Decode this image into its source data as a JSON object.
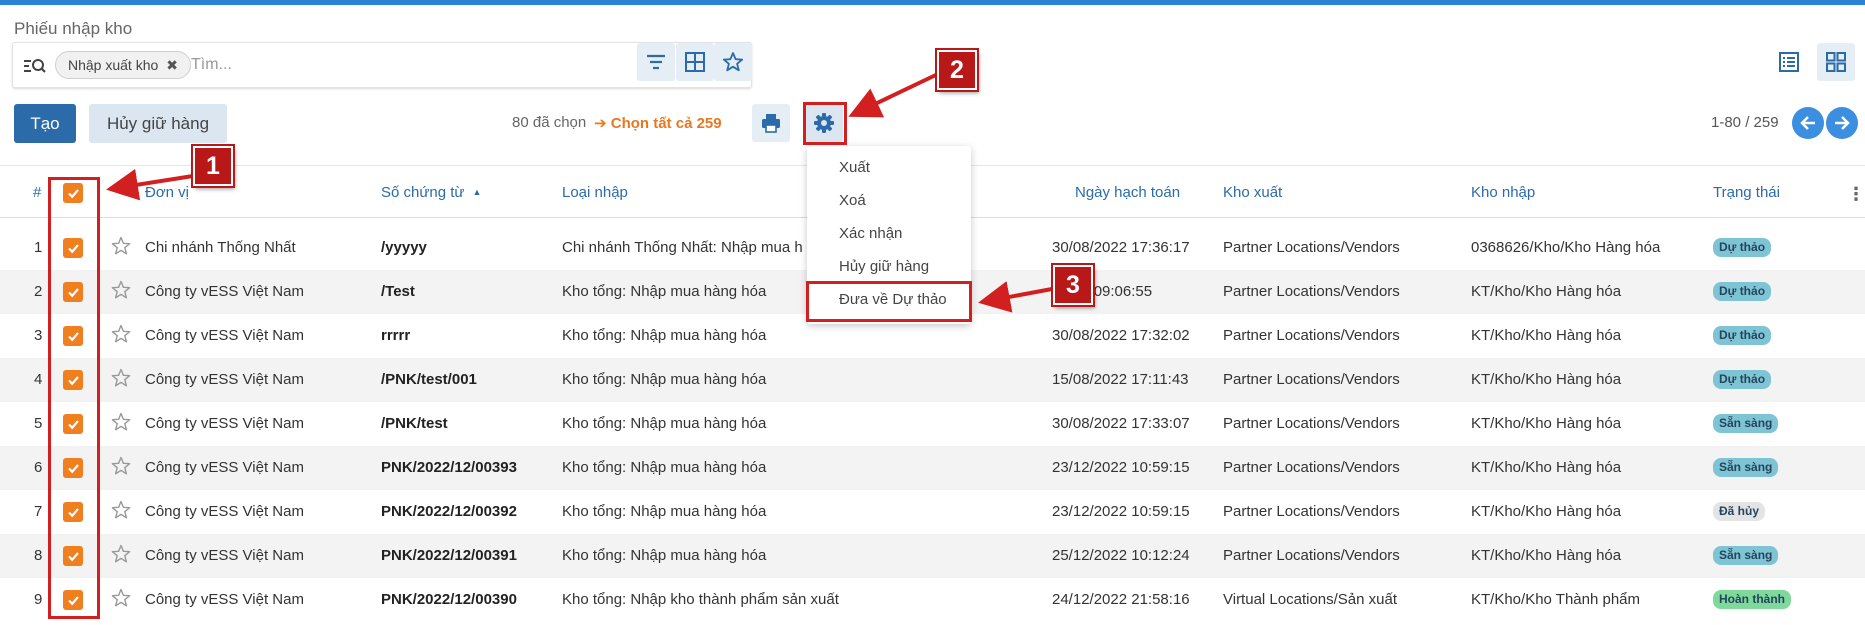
{
  "page": {
    "title": "Phiếu nhập kho"
  },
  "search": {
    "facet_label": "Nhập xuất kho",
    "facet_remove": "✖",
    "placeholder": "Tìm..."
  },
  "toolbar": {
    "create_label": "Tạo",
    "cancel_hold_label": "Hủy giữ hàng",
    "selected_text": "80 đã chọn",
    "select_all_text": "➔ Chọn tất cả 259",
    "pager_text": "1-80 / 259"
  },
  "actions_menu": {
    "items": [
      {
        "label": "Xuất"
      },
      {
        "label": "Xoá"
      },
      {
        "label": "Xác nhận"
      },
      {
        "label": "Hủy giữ hàng"
      },
      {
        "label": "Đưa về Dự thảo"
      }
    ]
  },
  "table": {
    "columns": {
      "index": "#",
      "unit": "Đơn vị",
      "doc_no": "Số chứng từ",
      "import_type": "Loại nhập",
      "posting_date": "Ngày hạch toán",
      "source_wh": "Kho xuất",
      "dest_wh": "Kho nhập",
      "status": "Trạng thái"
    },
    "sort_indicator": "▲",
    "kebab": "⋮",
    "rows": [
      {
        "index": "1",
        "unit": "Chi nhánh Thống Nhất",
        "doc_no": "/yyyyy",
        "import_type": "Chi nhánh Thống Nhất: Nhập mua h",
        "posting_date": "30/08/2022 17:36:17",
        "source_wh": "Partner Locations/Vendors",
        "dest_wh": "0368626/Kho/Kho Hàng hóa",
        "status": "Dự thảo"
      },
      {
        "index": "2",
        "unit": "Công ty vESS Việt Nam",
        "doc_no": "/Test",
        "import_type": "Kho tổng: Nhập mua hàng hóa",
        "posting_date": "/2022 09:06:55",
        "source_wh": "Partner Locations/Vendors",
        "dest_wh": "KT/Kho/Kho Hàng hóa",
        "status": "Dự thảo"
      },
      {
        "index": "3",
        "unit": "Công ty vESS Việt Nam",
        "doc_no": "rrrrr",
        "import_type": "Kho tổng: Nhập mua hàng hóa",
        "posting_date": "30/08/2022 17:32:02",
        "source_wh": "Partner Locations/Vendors",
        "dest_wh": "KT/Kho/Kho Hàng hóa",
        "status": "Dự thảo"
      },
      {
        "index": "4",
        "unit": "Công ty vESS Việt Nam",
        "doc_no": "/PNK/test/001",
        "import_type": "Kho tổng: Nhập mua hàng hóa",
        "posting_date": "15/08/2022 17:11:43",
        "source_wh": "Partner Locations/Vendors",
        "dest_wh": "KT/Kho/Kho Hàng hóa",
        "status": "Dự thảo"
      },
      {
        "index": "5",
        "unit": "Công ty vESS Việt Nam",
        "doc_no": "/PNK/test",
        "import_type": "Kho tổng: Nhập mua hàng hóa",
        "posting_date": "30/08/2022 17:33:07",
        "source_wh": "Partner Locations/Vendors",
        "dest_wh": "KT/Kho/Kho Hàng hóa",
        "status": "Sẵn sàng"
      },
      {
        "index": "6",
        "unit": "Công ty vESS Việt Nam",
        "doc_no": "PNK/2022/12/00393",
        "import_type": "Kho tổng: Nhập mua hàng hóa",
        "posting_date": "23/12/2022 10:59:15",
        "source_wh": "Partner Locations/Vendors",
        "dest_wh": "KT/Kho/Kho Hàng hóa",
        "status": "Sẵn sàng"
      },
      {
        "index": "7",
        "unit": "Công ty vESS Việt Nam",
        "doc_no": "PNK/2022/12/00392",
        "import_type": "Kho tổng: Nhập mua hàng hóa",
        "posting_date": "23/12/2022 10:59:15",
        "source_wh": "Partner Locations/Vendors",
        "dest_wh": "KT/Kho/Kho Hàng hóa",
        "status": "Đã hủy"
      },
      {
        "index": "8",
        "unit": "Công ty vESS Việt Nam",
        "doc_no": "PNK/2022/12/00391",
        "import_type": "Kho tổng: Nhập mua hàng hóa",
        "posting_date": "25/12/2022 10:12:24",
        "source_wh": "Partner Locations/Vendors",
        "dest_wh": "KT/Kho/Kho Hàng hóa",
        "status": "Sẵn sàng"
      },
      {
        "index": "9",
        "unit": "Công ty vESS Việt Nam",
        "doc_no": "PNK/2022/12/00390",
        "import_type": "Kho tổng: Nhập kho thành phẩm sản xuất",
        "posting_date": "24/12/2022 21:58:16",
        "source_wh": "Virtual Locations/Sản xuất",
        "dest_wh": "KT/Kho/Kho Thành phẩm",
        "status": "Hoàn thành"
      }
    ]
  },
  "status_colors": {
    "Dự thảo": "#7fc4d4",
    "Sẵn sàng": "#7fc4d4",
    "Đã hủy": "#e4e4e4",
    "Hoàn thành": "#7ed99a"
  },
  "annotations": {
    "callout_1": "1",
    "callout_2": "2",
    "callout_3": "3",
    "color": "#d21f1f"
  },
  "colors": {
    "primary": "#2b6ba9",
    "accent": "#f07f20",
    "link": "#e8771e"
  }
}
